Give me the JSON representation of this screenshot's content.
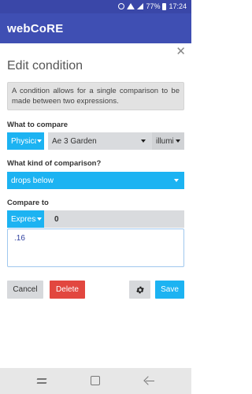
{
  "status_bar": {
    "battery": "77%",
    "time": "17:24"
  },
  "app": {
    "title": "webCoRE"
  },
  "dialog": {
    "close_symbol": "✕",
    "title": "Edit condition",
    "info": "A condition allows for a single comparison to be made between two expressions.",
    "what_to_compare": {
      "label": "What to compare",
      "type_value": "Physical",
      "device_value": "Ae 3 Garden",
      "attribute_value": "illuminance"
    },
    "comparison": {
      "label": "What kind of comparison?",
      "value": "drops below"
    },
    "compare_to": {
      "label": "Compare to",
      "type_value": "Expression",
      "value": "0",
      "expression": ".16"
    },
    "buttons": {
      "cancel": "Cancel",
      "delete": "Delete",
      "save": "Save"
    }
  },
  "colors": {
    "app_bar": "#3f4fb3",
    "accent": "#1cb3f2",
    "danger": "#e2473f",
    "neutral": "#d9dbde"
  },
  "icons": {
    "close": "close-icon",
    "settings": "gear-icon",
    "nav_recent": "recent-apps-icon",
    "nav_home": "home-icon",
    "nav_back": "back-icon"
  }
}
